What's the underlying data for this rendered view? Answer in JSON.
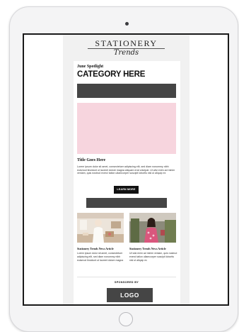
{
  "newsletter": {
    "brand": {
      "name": "STATIONERY",
      "script": "Trends"
    },
    "eyebrow": "June Spotlight",
    "category_title": "CATEGORY HERE",
    "feature": {
      "title": "Title Goes Here",
      "body": "Lorem ipsum dolor sit amet, consectetuer adipiscing elit, sed diam nonummy nibh euismod tincidunt ut laoreet dolore magna aliquam erat volutpat. Ut wisi enim ad minim veniam, quis nostrud exerci tation ullamcorper suscipit lobortis nisl ut aliquip ex",
      "button_label": "LEARN MORE",
      "hero_color": "#f7d5de"
    },
    "news": [
      {
        "title": "Stationery Trends News Article",
        "body": "Lorem ipsum dolor sit amet, consectetuer adipiscing elit, sed diam nonummy nibh euismod tincidunt ut laoreet dolore magna"
      },
      {
        "title": "Stationery Trends News Article",
        "body": "Ut wisi enim ad minim veniam, quis nostrud exerci tation ullamcorper suscipit lobortis nisl ut aliquip ex"
      }
    ],
    "sponsored_label": "SPONSORED BY",
    "sponsor_logo": "LOGO"
  },
  "colors": {
    "banner": "#454545",
    "hero_pink": "#f7d5de",
    "page_bg": "#f1f1f1"
  }
}
